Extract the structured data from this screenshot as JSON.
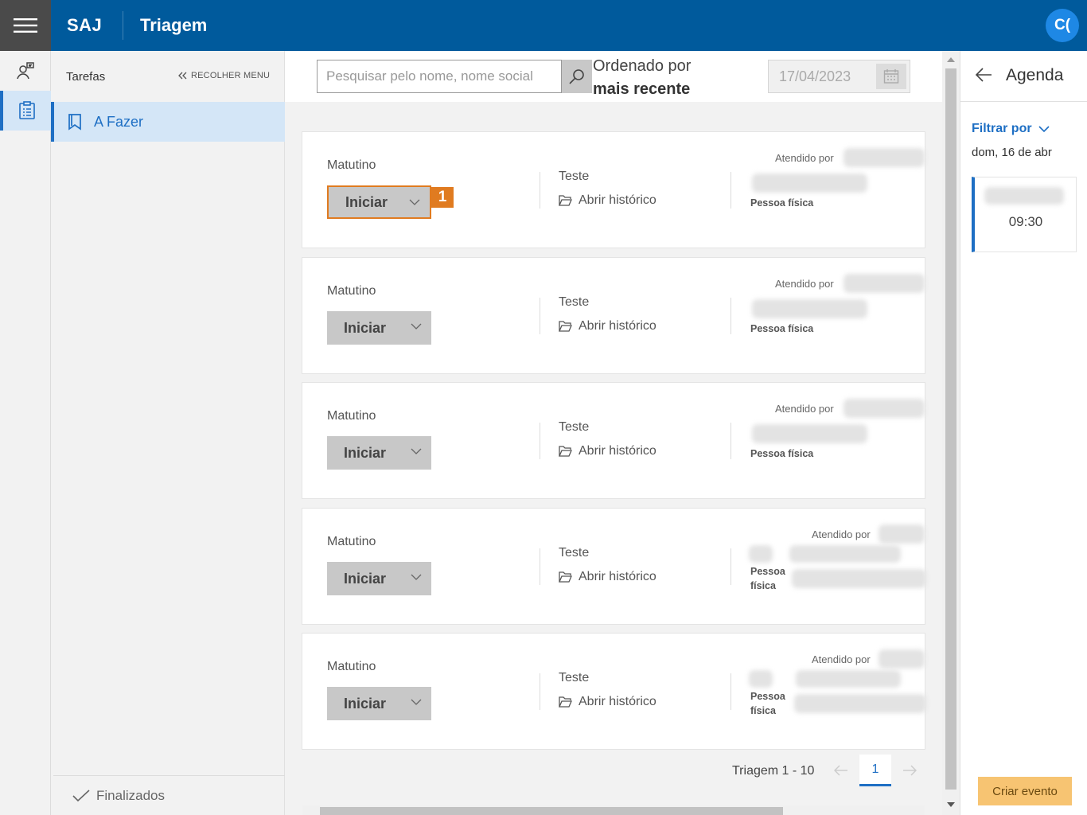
{
  "header": {
    "brand": "SAJ",
    "title": "Triagem",
    "avatar_initials": "C("
  },
  "nav": {
    "title": "Tarefas",
    "collapse_label": "RECOLHER MENU",
    "items": [
      {
        "label": "A Fazer",
        "icon": "bookmark-icon"
      }
    ],
    "footer_label": "Finalizados"
  },
  "toolbar": {
    "search_placeholder": "Pesquisar pelo nome, nome social",
    "order_label": "Ordenado por",
    "order_value": "mais recente",
    "date_value": "17/04/2023"
  },
  "cards": [
    {
      "shift": "Matutino",
      "start_label": "Iniciar",
      "test_label": "Teste",
      "history_label": "Abrir histórico",
      "served_label": "Atendido por",
      "person_type": "Pessoa física"
    },
    {
      "shift": "Matutino",
      "start_label": "Iniciar",
      "test_label": "Teste",
      "history_label": "Abrir histórico",
      "served_label": "Atendido por",
      "person_type": "Pessoa física"
    },
    {
      "shift": "Matutino",
      "start_label": "Iniciar",
      "test_label": "Teste",
      "history_label": "Abrir histórico",
      "served_label": "Atendido por",
      "person_type": "Pessoa física"
    },
    {
      "shift": "Matutino",
      "start_label": "Iniciar",
      "test_label": "Teste",
      "history_label": "Abrir histórico",
      "served_label": "Atendido por",
      "person_type_line1": "Pessoa",
      "person_type_line2": "física"
    },
    {
      "shift": "Matutino",
      "start_label": "Iniciar",
      "test_label": "Teste",
      "history_label": "Abrir histórico",
      "served_label": "Atendido por",
      "person_type_line1": "Pessoa",
      "person_type_line2": "física"
    }
  ],
  "annotation_marker": "1",
  "pagination": {
    "label": "Triagem 1 - 10",
    "current_page": "1"
  },
  "agenda": {
    "title": "Agenda",
    "filter_label": "Filtrar por",
    "date_label": "dom, 16 de abr",
    "events": [
      {
        "time": "09:30"
      }
    ],
    "create_label": "Criar evento"
  },
  "colors": {
    "header_bg": "#005a9c",
    "accent": "#1e6fc4",
    "highlight": "#e07b20",
    "create_button": "#f7c472"
  }
}
